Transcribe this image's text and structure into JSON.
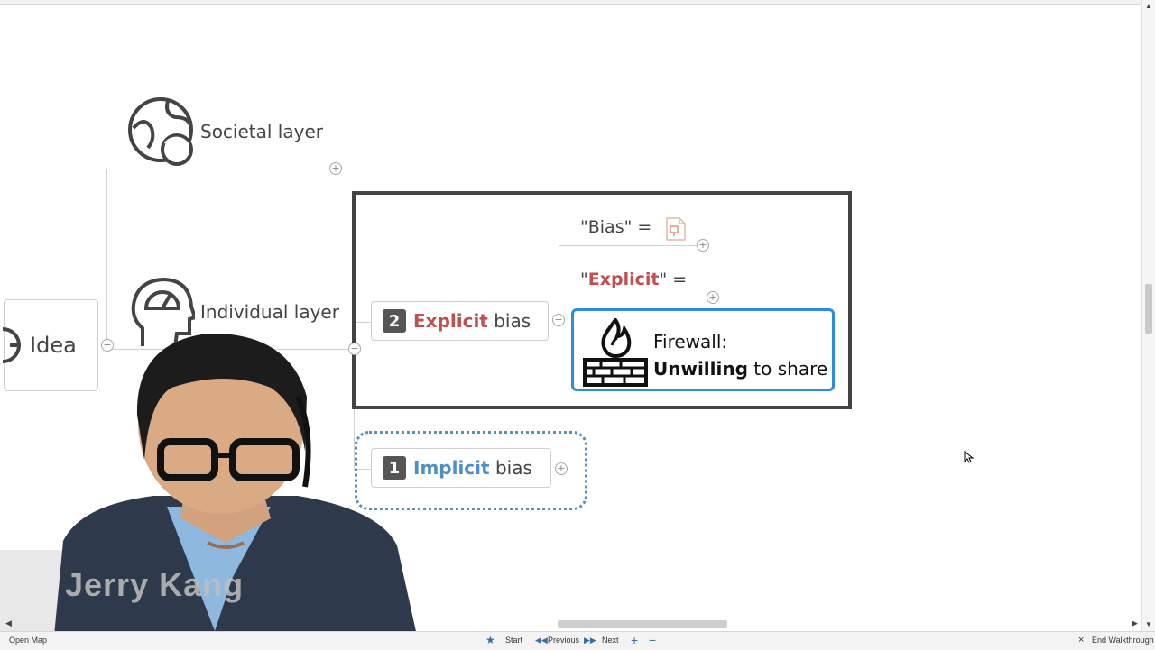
{
  "map": {
    "central": {
      "label": "Idea"
    },
    "societal": {
      "label": "Societal layer"
    },
    "individual": {
      "label": "Individual layer"
    },
    "explicit_node": {
      "number": "2",
      "keyword": "Explicit",
      "rest": "bias"
    },
    "implicit_node": {
      "number": "1",
      "keyword": "Implicit",
      "rest": "bias"
    },
    "bias_def": {
      "label": "\"Bias\" ="
    },
    "explicit_def": {
      "quote_open": "\"",
      "keyword": "Explicit",
      "quote_close": "\" ="
    },
    "firewall": {
      "line1": "Firewall:",
      "bold": "Unwilling",
      "rest": "to share"
    }
  },
  "video": {
    "name": "Jerry Kang"
  },
  "bottom_bar": {
    "open_map": "Open Map",
    "start": "Start",
    "previous": "Previous",
    "next": "Next",
    "zoom_in": "+",
    "zoom_out": "−",
    "end": "End Walkthrough",
    "close": "×"
  },
  "colors": {
    "explicit": "#c0504d",
    "implicit": "#4e8fc7",
    "firewall_border": "#2b8de0",
    "dotted_frame": "#5a8fb3"
  }
}
